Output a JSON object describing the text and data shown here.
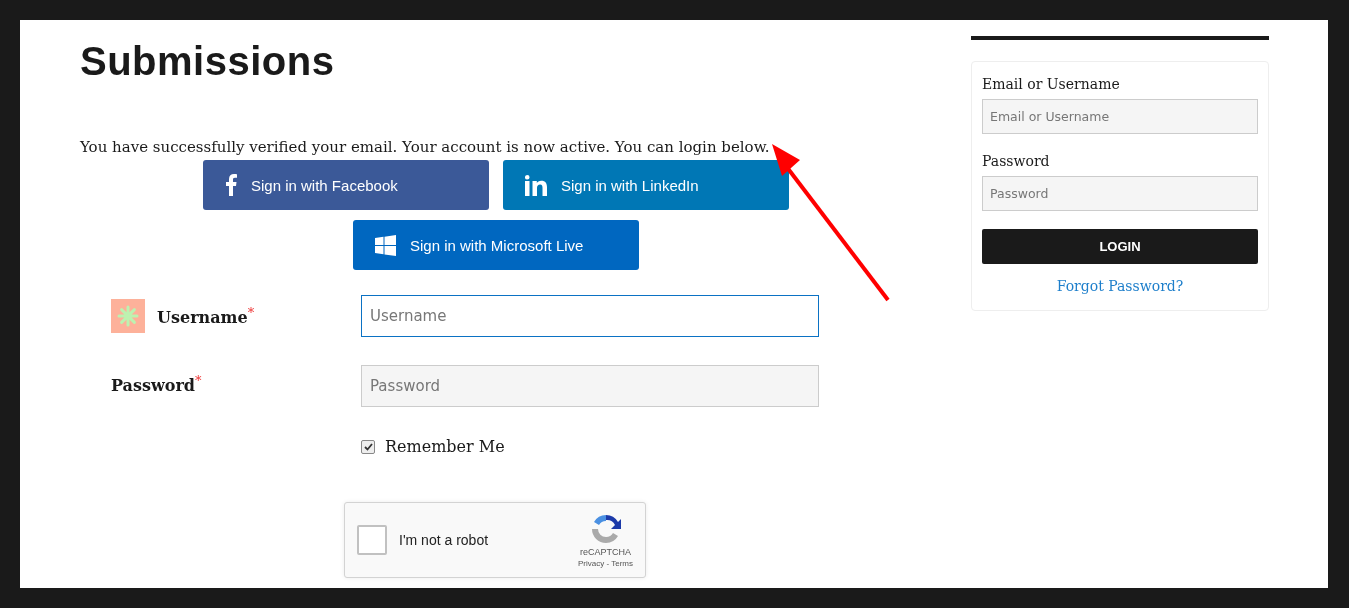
{
  "main": {
    "title": "Submissions",
    "message": "You have successfully verified your email. Your account is now active. You can login below.",
    "social_buttons": [
      {
        "kind": "facebook",
        "label": "Sign in with Facebook"
      },
      {
        "kind": "linkedin",
        "label": "Sign in with LinkedIn"
      },
      {
        "kind": "microsoft",
        "label": "Sign in with Microsoft Live"
      }
    ],
    "fields": [
      {
        "label": "Username",
        "required_mark": "*",
        "placeholder": "Username",
        "avatar": true,
        "focused": true
      },
      {
        "label": "Password",
        "required_mark": "*",
        "placeholder": "Password",
        "avatar": false,
        "focused": false
      }
    ],
    "remember": {
      "label": "Remember Me",
      "checked": true
    },
    "captcha": {
      "label": "I'm not a robot",
      "checked": false,
      "brand": "reCAPTCHA",
      "links": "Privacy - Terms"
    }
  },
  "sidebar": {
    "fields": [
      {
        "label": "Email or Username",
        "placeholder": "Email or Username"
      },
      {
        "label": "Password",
        "placeholder": "Password"
      }
    ],
    "button": "LOGIN",
    "link": "Forgot Password?"
  }
}
